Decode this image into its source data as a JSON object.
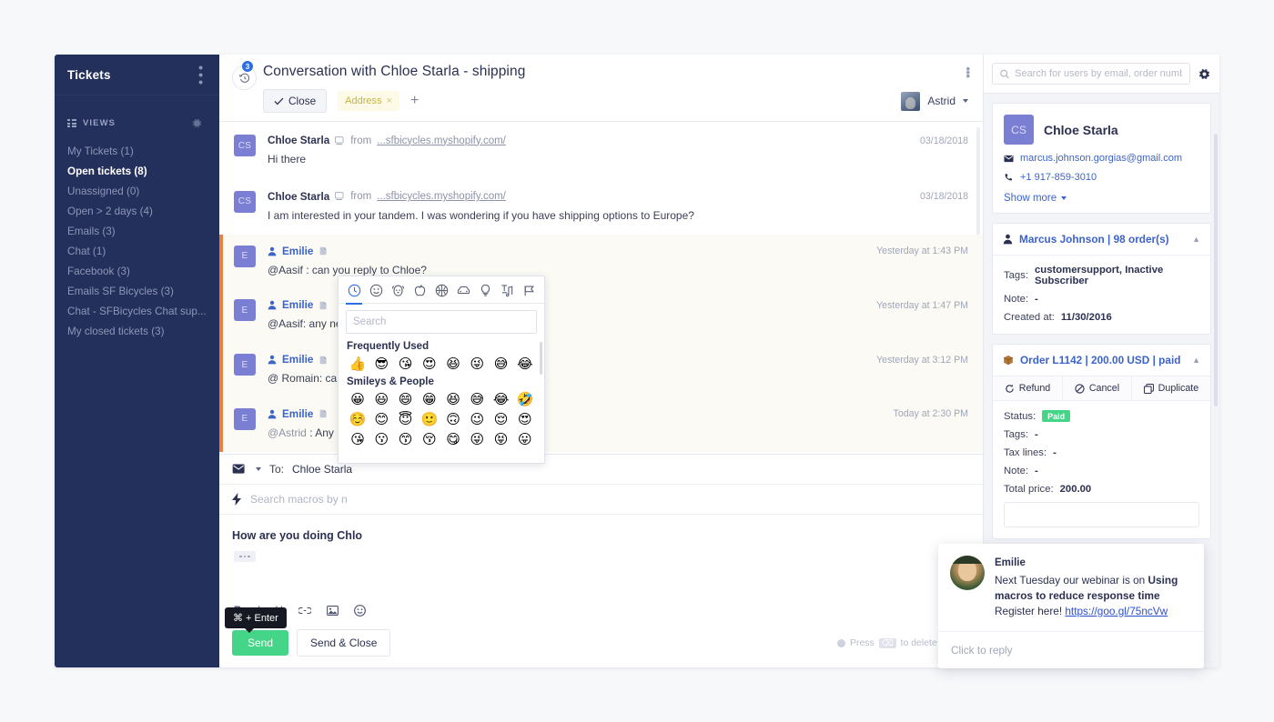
{
  "sidebar": {
    "title": "Tickets",
    "views_label": "VIEWS",
    "items": [
      {
        "label": "My Tickets (1)"
      },
      {
        "label": "Open tickets (8)"
      },
      {
        "label": "Unassigned (0)"
      },
      {
        "label": "Open > 2 days (4)"
      },
      {
        "label": "Emails (3)"
      },
      {
        "label": "Chat (1)"
      },
      {
        "label": "Facebook (3)"
      },
      {
        "label": "Emails SF Bicycles (3)"
      },
      {
        "label": "Chat - SFBicycles Chat sup..."
      },
      {
        "label": "My closed tickets (3)"
      }
    ],
    "active_index": 1
  },
  "header": {
    "title": "Conversation with Chloe Starla - shipping",
    "history_badge": "3",
    "close_label": "Close",
    "tag_label": "Address",
    "tag_close": "×",
    "add_tag": "+",
    "agent_name": "Astrid"
  },
  "messages": [
    {
      "type": "email",
      "initials": "CS",
      "author": "Chloe Starla",
      "from_prefix": "from",
      "from_link": "...sfbicycles.myshopify.com/",
      "time": "03/18/2018",
      "text": "Hi there"
    },
    {
      "type": "email",
      "initials": "CS",
      "author": "Chloe Starla",
      "from_prefix": "from",
      "from_link": "...sfbicycles.myshopify.com/",
      "time": "03/18/2018",
      "text": "I am interested in your tandem. I was wondering if you have shipping options to Europe?"
    },
    {
      "type": "note",
      "initials": "E",
      "author": "Emilie",
      "time": "Yesterday at 1:43 PM",
      "mention": "@Aasif",
      "text": " : can you reply to Chloe?"
    },
    {
      "type": "note",
      "initials": "E",
      "author": "Emilie",
      "time": "Yesterday at 1:47 PM",
      "mention": "@Aasif",
      "text": ": any news from Chloe?"
    },
    {
      "type": "note",
      "initials": "E",
      "author": "Emilie",
      "time": "Yesterday at 3:12 PM",
      "mention": "@ Romain",
      "text": ": can you follow up?"
    },
    {
      "type": "note",
      "initials": "E",
      "author": "Emilie",
      "time": "Today at 2:30 PM",
      "mention": "@Astrid",
      "text": " : Any news from Chloe?"
    }
  ],
  "composer": {
    "to_label": "To:",
    "to_value": "Chloe Starla",
    "macro_placeholder": "Search macros by n",
    "body_text": "How are you doing Chlo",
    "send_label": "Send",
    "send_close_label": "Send & Close",
    "tooltip": "⌘ + Enter",
    "delete_hint_pre": "Press",
    "delete_hint_key": "⌫",
    "delete_hint_post": "to delete the tick"
  },
  "emoji_picker": {
    "search_placeholder": "Search",
    "tabs": [
      {
        "name": "recent-tab",
        "icon": "clock-icon"
      },
      {
        "name": "smileys-tab",
        "icon": "smiley-icon"
      },
      {
        "name": "animals-tab",
        "icon": "animal-icon"
      },
      {
        "name": "food-tab",
        "icon": "apple-icon"
      },
      {
        "name": "activity-tab",
        "icon": "basketball-icon"
      },
      {
        "name": "travel-tab",
        "icon": "car-icon"
      },
      {
        "name": "objects-tab",
        "icon": "lightbulb-icon"
      },
      {
        "name": "symbols-tab",
        "icon": "symbols-icon"
      },
      {
        "name": "flags-tab",
        "icon": "flag-icon"
      }
    ],
    "active_tab": 0,
    "sections": [
      {
        "title": "Frequently Used",
        "emojis": [
          "👍",
          "😎",
          "😘",
          "😍",
          "😆",
          "😜",
          "😅",
          "😂"
        ]
      },
      {
        "title": "Smileys & People",
        "emojis": [
          "😀",
          "😃",
          "😄",
          "😁",
          "😆",
          "😅",
          "😂",
          "🤣",
          "☺️",
          "😊",
          "😇",
          "🙂",
          "🙃",
          "😉",
          "😌",
          "😍",
          "😘",
          "😗",
          "😙",
          "😚",
          "😋",
          "😜",
          "😝",
          "😛"
        ]
      }
    ]
  },
  "right_panel": {
    "search_placeholder": "Search for users by email, order numb",
    "customer": {
      "initials": "CS",
      "name": "Chloe Starla",
      "email": "marcus.johnson.gorgias@gmail.com",
      "phone": "+1 917-859-3010",
      "show_more": "Show more"
    },
    "profile_card": {
      "title": "Marcus Johnson | 98 order(s)",
      "rows": [
        {
          "k": "Tags:",
          "v": "customersupport, Inactive Subscriber"
        },
        {
          "k": "Note:",
          "v": "-"
        },
        {
          "k": "Created at:",
          "v": "11/30/2016"
        }
      ]
    },
    "order_card": {
      "title": "Order L1142 | 200.00 USD | paid",
      "actions": [
        "Refund",
        "Cancel",
        "Duplicate"
      ],
      "status_label": "Status:",
      "status_value": "Paid",
      "rows": [
        {
          "k": "Tags:",
          "v": "-"
        },
        {
          "k": "Tax lines:",
          "v": "-"
        },
        {
          "k": "Note:",
          "v": "-"
        },
        {
          "k": "Total price:",
          "v": "200.00"
        }
      ]
    }
  },
  "toast": {
    "name": "Emilie",
    "line1": "Next Tuesday our webinar is on ",
    "bold1": "Using macros to reduce response time",
    "line2": "Register here! ",
    "link": "https://goo.gl/75ncVw",
    "reply_placeholder": "Click to reply"
  },
  "colors": {
    "sidebar_bg": "#23305c",
    "accent_blue": "#3b63c9",
    "note_bar": "#e8813e",
    "green": "#45d588",
    "tag_yellow": "#c9b434"
  }
}
